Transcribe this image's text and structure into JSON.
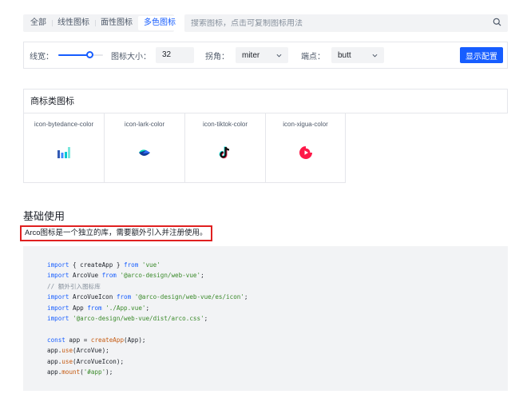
{
  "filter_tabs": [
    "全部",
    "线性图标",
    "面性图标",
    "多色图标"
  ],
  "active_tab_index": 3,
  "search": {
    "placeholder": "搜索图标，点击可复制图标用法"
  },
  "config": {
    "stroke_width_label": "线宽：",
    "stroke_width_value_fraction": 0.75,
    "size_label": "图标大小：",
    "size_value": "32",
    "linejoin_label": "拐角：",
    "linejoin_value": "miter",
    "linecap_label": "端点：",
    "linecap_value": "butt",
    "show_config_button": "显示配置"
  },
  "brand_section": {
    "title": "商标类图标",
    "icons": [
      {
        "name": "icon-bytedance-color",
        "icon": "bytedance-logo"
      },
      {
        "name": "icon-lark-color",
        "icon": "lark-logo"
      },
      {
        "name": "icon-tiktok-color",
        "icon": "tiktok-logo"
      },
      {
        "name": "icon-xigua-color",
        "icon": "xigua-logo"
      }
    ]
  },
  "basic_usage": {
    "title": "基础使用",
    "description": "Arco图标是一个独立的库，需要额外引入并注册使用。"
  },
  "colors": {
    "accent": "#165dff",
    "highlight_border": "#e02020",
    "code_background": "#f2f3f5"
  }
}
